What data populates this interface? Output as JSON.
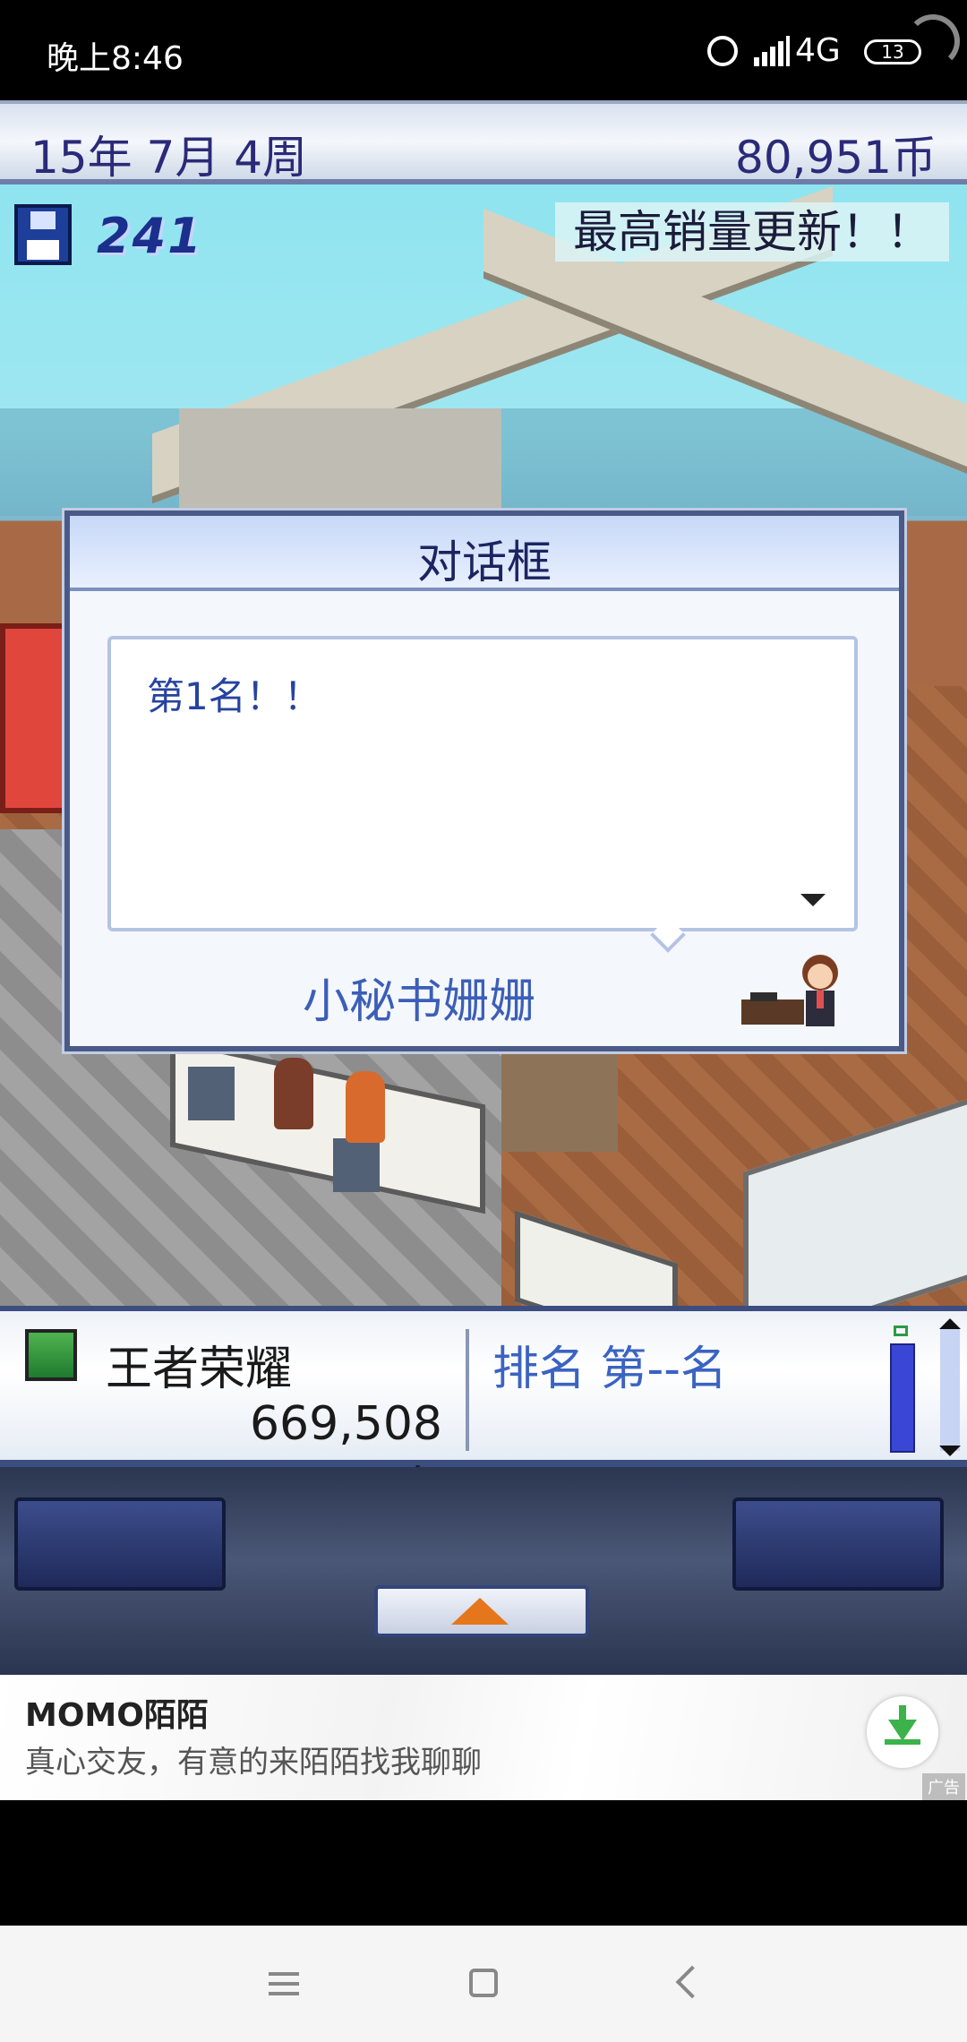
{
  "status_bar": {
    "time": "晚上8:46",
    "network": "4G",
    "battery": "13"
  },
  "top_bar": {
    "date": "15年 7月 4周",
    "money": "80,951币"
  },
  "scene": {
    "fans": "241",
    "banner": "最高销量更新！！"
  },
  "dialog": {
    "title": "对话框",
    "message": "第1名！！",
    "speaker": "小秘书姗姗"
  },
  "info_panel": {
    "game_name": "王者荣耀",
    "sales": "669,508套",
    "rank": "排名 第--名"
  },
  "ad": {
    "title": "MOMO陌陌",
    "description": "真心交友，有意的来陌陌找我聊聊",
    "tag": "广告"
  },
  "colors": {
    "dialog_border": "#4a5a88",
    "text_blue": "#3b5eb8",
    "accent_orange": "#e5761c"
  },
  "icons": [
    "alarm-icon",
    "signal-icon",
    "battery-icon",
    "floppy-disk-icon",
    "download-icon",
    "menu-icon",
    "home-icon",
    "back-icon"
  ]
}
